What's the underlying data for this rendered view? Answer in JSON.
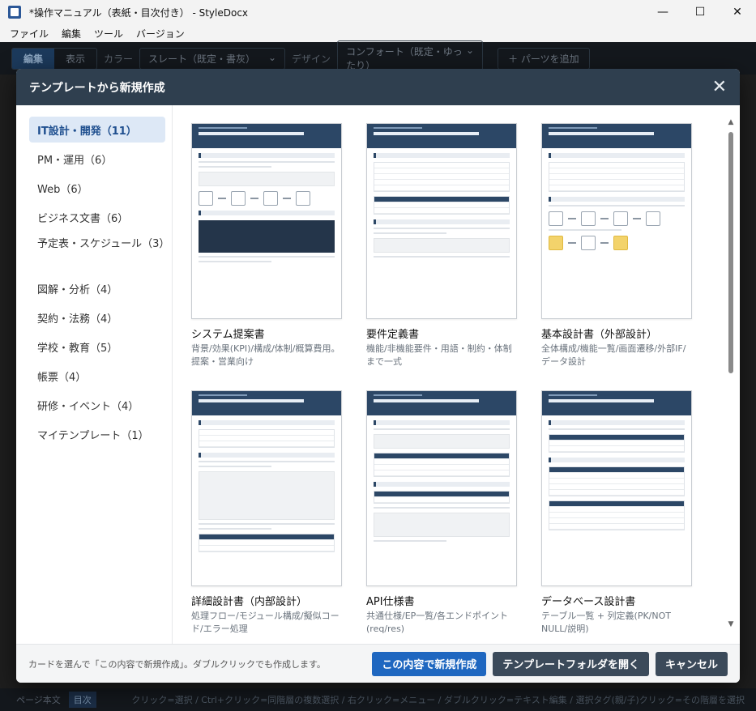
{
  "window": {
    "title": "*操作マニュアル（表紙・目次付き） - StyleDocx",
    "controls": {
      "minimize": "—",
      "maximize": "☐",
      "close": "✕"
    }
  },
  "menu": [
    "ファイル",
    "編集",
    "ツール",
    "バージョン"
  ],
  "toolbar": {
    "mode_edit": "編集",
    "mode_view": "表示",
    "color_label": "カラー",
    "color_value": "スレート（既定・書灰）",
    "design_label": "デザイン",
    "design_value": "コンフォート（既定・ゆったり）",
    "add_parts": "＋ パーツを追加",
    "chevron": "⌄"
  },
  "statusbar": {
    "tab_body": "ページ本文",
    "tab_toc": "目次",
    "hint": "クリック=選択 / Ctrl+クリック=同階層の複数選択 / 右クリック=メニュー / ダブルクリック=テキスト編集 / 選択タグ(親/子)クリック=その階層を選択"
  },
  "dialog": {
    "title": "テンプレートから新規作成",
    "close": "✕",
    "categories": [
      "IT設計・開発（11）",
      "PM・運用（6）",
      "Web（6）",
      "ビジネス文書（6）",
      "予定表・スケジュール（3）",
      "図解・分析（4）",
      "契約・法務（4）",
      "学校・教育（5）",
      "帳票（4）",
      "研修・イベント（4）",
      "マイテンプレート（1）"
    ],
    "templates": [
      {
        "name": "システム提案書",
        "desc": "背景/効果(KPI)/構成/体制/概算費用。提案・営業向け"
      },
      {
        "name": "要件定義書",
        "desc": "機能/非機能要件・用語・制約・体制まで一式"
      },
      {
        "name": "基本設計書（外部設計）",
        "desc": "全体構成/機能一覧/画面遷移/外部IF/データ設計"
      },
      {
        "name": "詳細設計書（内部設計）",
        "desc": "処理フロー/モジュール構成/擬似コード/エラー処理"
      },
      {
        "name": "API仕様書",
        "desc": "共通仕様/EP一覧/各エンドポイント(req/res)"
      },
      {
        "name": "データベース設計書",
        "desc": "テーブル一覧 + 列定義(PK/NOT NULL/説明)"
      }
    ],
    "scroll_up": "▲",
    "scroll_down": "▼",
    "footer_hint": "カードを選んで「この内容で新規作成」。ダブルクリックでも作成します。",
    "btn_create": "この内容で新規作成",
    "btn_open_folder": "テンプレートフォルダを開く",
    "btn_cancel": "キャンセル"
  },
  "colors": {
    "header": "#2f3f4f",
    "primary": "#1f67c0",
    "secondary": "#3b4a5a",
    "selected_category": "#dde8f6"
  }
}
